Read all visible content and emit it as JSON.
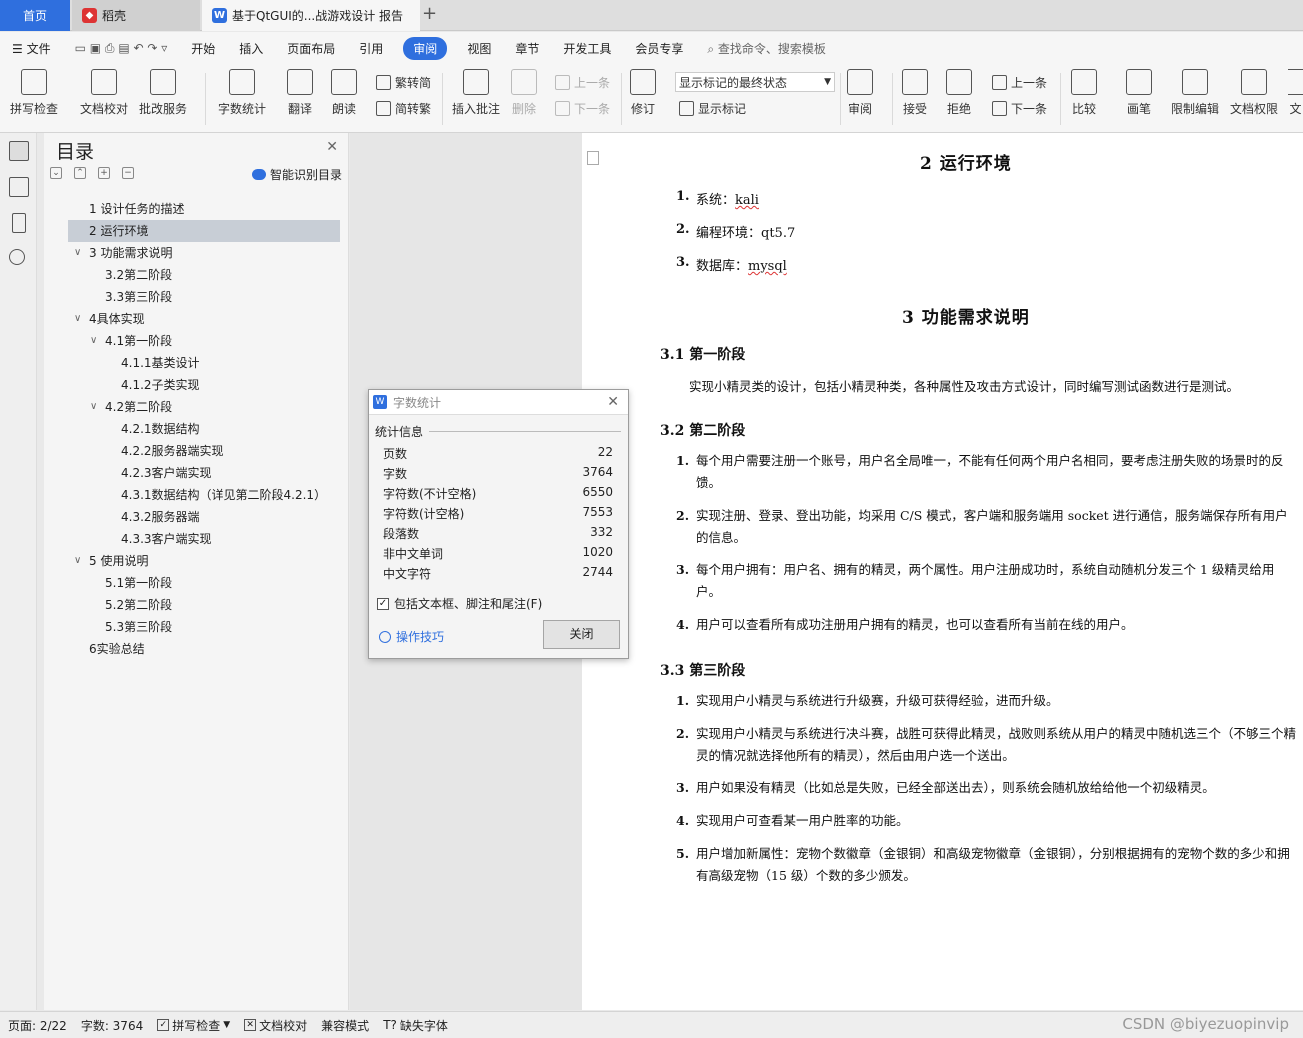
{
  "tabs": {
    "home": "首页",
    "daoke": "稻壳",
    "doc": "基于QtGUI的...战游戏设计 报告",
    "new_tab": "+"
  },
  "menubar": {
    "file": "文件",
    "items": [
      "开始",
      "插入",
      "页面布局",
      "引用",
      "审阅",
      "视图",
      "章节",
      "开发工具",
      "会员专享"
    ],
    "active": "审阅",
    "search": "查找命令、搜索模板"
  },
  "ribbon": {
    "spell": "拼写检查",
    "proof": "文档校对",
    "batch": "批改服务",
    "wordcount": "字数统计",
    "translate": "翻译",
    "read": "朗读",
    "trad": "繁转简",
    "simp": "简转繁",
    "insert_comment": "插入批注",
    "delete": "删除",
    "prev_c": "上一条",
    "next_c": "下一条",
    "revise": "修订",
    "markup_state": "显示标记的最终状态",
    "show_markup": "显示标记",
    "review": "审阅",
    "accept": "接受",
    "reject": "拒绝",
    "prev": "上一条",
    "next": "下一条",
    "compare": "比较",
    "pen": "画笔",
    "restrict": "限制编辑",
    "doc_perm": "文档权限",
    "more": "文"
  },
  "toc": {
    "title": "目录",
    "smart": "智能识别目录",
    "items": [
      "1 设计任务的描述",
      "2 运行环境",
      "3 功能需求说明",
      "3.2第二阶段",
      "3.3第三阶段",
      "4具体实现",
      "4.1第一阶段",
      "4.1.1基类设计",
      "4.1.2子类实现",
      "4.2第二阶段",
      "4.2.1数据结构",
      "4.2.2服务器端实现",
      "4.2.3客户端实现",
      "4.3.1数据结构（详见第二阶段4.2.1）",
      "4.3.2服务器端",
      "4.3.3客户端实现",
      "5 使用说明",
      "5.1第一阶段",
      "5.2第二阶段",
      "5.3第三阶段",
      "6实验总结"
    ]
  },
  "document": {
    "h_env": "2   运行环境",
    "env": [
      {
        "n": "1.",
        "t": "系统：",
        "v": "kali"
      },
      {
        "n": "2.",
        "t": "编程环境：",
        "v": "qt5.7"
      },
      {
        "n": "3.",
        "t": "数据库：",
        "v": "mysql"
      }
    ],
    "h_func": "3   功能需求说明",
    "s31": "3.1   第一阶段",
    "p31": "实现小精灵类的设计，包括小精灵种类，各种属性及攻击方式设计，同时编写测试函数进行是测试。",
    "s32": "3.2   第二阶段",
    "l32": [
      "每个用户需要注册一个账号，用户名全局唯一，不能有任何两个用户名相同，要考虑注册失败的场景时的反馈。",
      "实现注册、登录、登出功能，均采用 C/S 模式，客户端和服务端用 socket 进行通信，服务端保存所有用户的信息。",
      "每个用户拥有：用户名、拥有的精灵，两个属性。用户注册成功时，系统自动随机分发三个 1 级精灵给用户。",
      "用户可以查看所有成功注册用户拥有的精灵，也可以查看所有当前在线的用户。"
    ],
    "s33": "3.3   第三阶段",
    "l33": [
      "实现用户小精灵与系统进行升级赛，升级可获得经验，进而升级。",
      "实现用户小精灵与系统进行决斗赛，战胜可获得此精灵，战败则系统从用户的精灵中随机选三个（不够三个精灵的情况就选择他所有的精灵），然后由用户选一个送出。",
      "用户如果没有精灵（比如总是失败，已经全部送出去），则系统会随机放给给他一个初级精灵。",
      "实现用户可查看某一用户胜率的功能。",
      "用户增加新属性：宠物个数徽章（金银铜）和高级宠物徽章（金银铜），分别根据拥有的宠物个数的多少和拥有高级宠物（15 级）个数的多少颁发。"
    ]
  },
  "dialog": {
    "title": "字数统计",
    "group": "统计信息",
    "rows": [
      {
        "k": "页数",
        "v": "22"
      },
      {
        "k": "字数",
        "v": "3764"
      },
      {
        "k": "字符数(不计空格)",
        "v": "6550"
      },
      {
        "k": "字符数(计空格)",
        "v": "7553"
      },
      {
        "k": "段落数",
        "v": "332"
      },
      {
        "k": "非中文单词",
        "v": "1020"
      },
      {
        "k": "中文字符",
        "v": "2744"
      }
    ],
    "check": "包括文本框、脚注和尾注(F)",
    "tips": "操作技巧",
    "close": "关闭"
  },
  "status": {
    "page": "页面: 2/22",
    "words": "字数: 3764",
    "spell": "拼写检查",
    "proof": "文档校对",
    "compat": "兼容模式",
    "missing": "缺失字体"
  },
  "watermark": "CSDN @biyezuopinvip",
  "colors": {
    "accent": "#2f6fde"
  }
}
